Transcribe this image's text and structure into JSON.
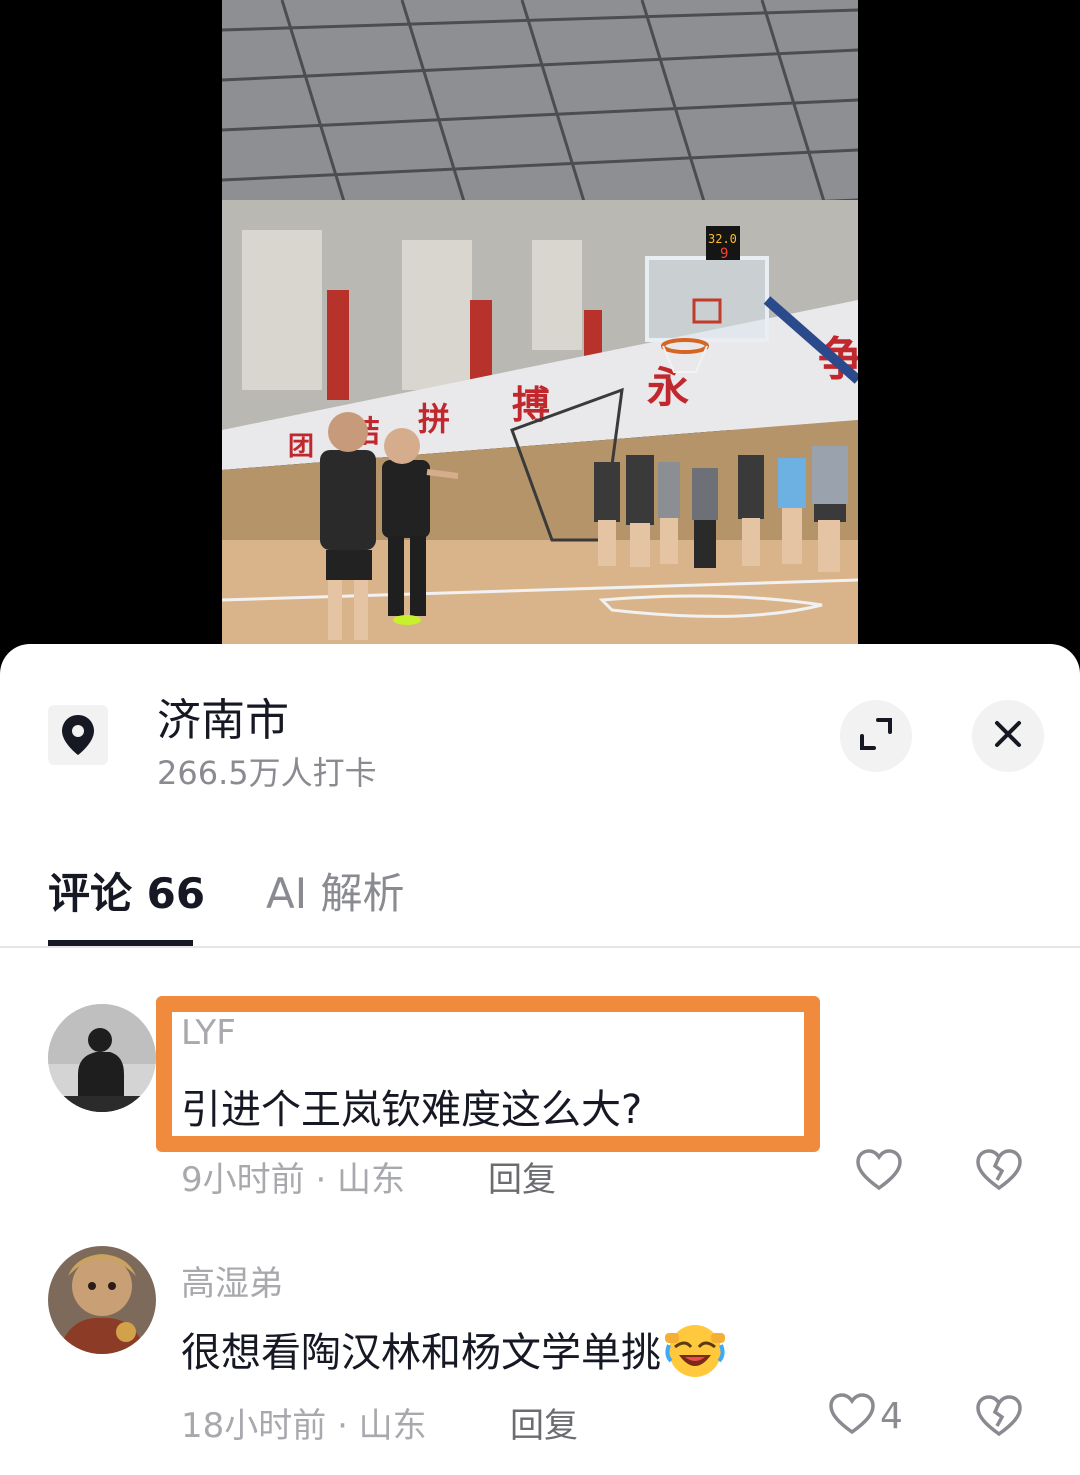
{
  "location": {
    "name": "济南市",
    "checkins": "266.5万人打卡"
  },
  "tabs": [
    {
      "label": "评论 66",
      "active": true
    },
    {
      "label": "AI 解析",
      "active": false
    }
  ],
  "video": {
    "banner_chars": [
      "团",
      "结",
      "拼",
      "搏",
      "永",
      "争"
    ],
    "shot_clock": "32.0",
    "score": "9"
  },
  "comments": [
    {
      "user": "LYF",
      "text": "引进个王岚钦难度这么大?",
      "time_location": "9小时前 · 山东",
      "reply_label": "回复",
      "likes": "",
      "highlighted": true
    },
    {
      "user": "高湿弟",
      "text": "很想看陶汉林和杨文学单挑",
      "time_location": "18小时前 · 山东",
      "reply_label": "回复",
      "likes": "4",
      "highlighted": false
    }
  ],
  "colors": {
    "highlight_border": "#f08a3c",
    "primary_text": "#161823",
    "secondary_text": "#8a8b91"
  },
  "icons": [
    "location-pin-icon",
    "expand-icon",
    "close-icon",
    "heart-icon",
    "broken-heart-icon",
    "laughing-emoji-icon"
  ]
}
